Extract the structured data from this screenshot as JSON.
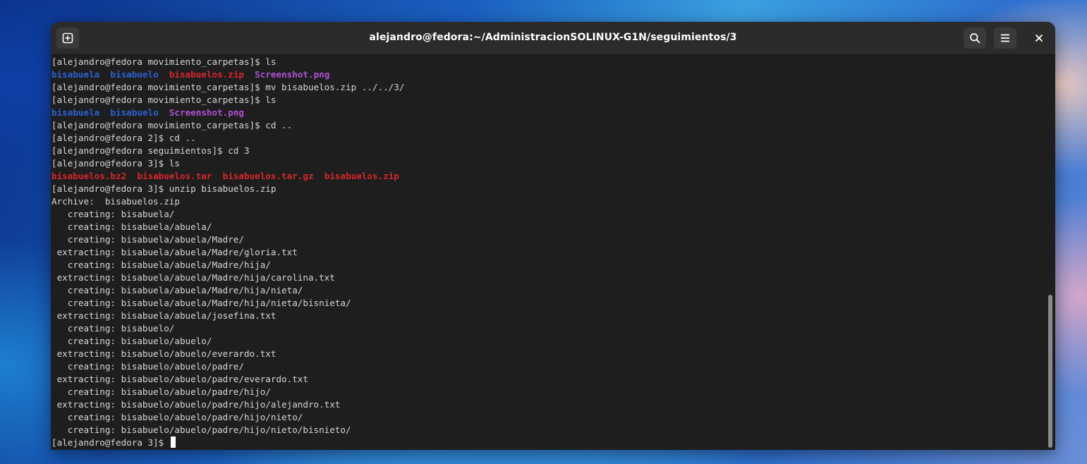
{
  "window": {
    "title": "alejandro@fedora:~/AdministracionSOLINUX-G1N/seguimientos/3"
  },
  "icons": {
    "new_tab": "new-tab-icon",
    "search": "search-icon",
    "menu": "hamburger-menu-icon",
    "close": "close-icon"
  },
  "colors": {
    "directory": "#2a62d6",
    "archive": "#d9262d",
    "image": "#b150d8",
    "text": "#d6d6d6",
    "background": "#1e1e1e"
  },
  "terminal": {
    "lines": [
      [
        {
          "t": "[alejandro@fedora movimiento_carpetas]$ ls",
          "k": ""
        }
      ],
      [
        {
          "t": "bisabuela",
          "k": "dir"
        },
        {
          "t": "  ",
          "k": ""
        },
        {
          "t": "bisabuelo",
          "k": "dir"
        },
        {
          "t": "  ",
          "k": ""
        },
        {
          "t": "bisabuelos.zip",
          "k": "arc"
        },
        {
          "t": "  ",
          "k": ""
        },
        {
          "t": "Screenshot.png",
          "k": "img"
        }
      ],
      [
        {
          "t": "[alejandro@fedora movimiento_carpetas]$ mv bisabuelos.zip ../../3/",
          "k": ""
        }
      ],
      [
        {
          "t": "[alejandro@fedora movimiento_carpetas]$ ls",
          "k": ""
        }
      ],
      [
        {
          "t": "bisabuela",
          "k": "dir"
        },
        {
          "t": "  ",
          "k": ""
        },
        {
          "t": "bisabuelo",
          "k": "dir"
        },
        {
          "t": "  ",
          "k": ""
        },
        {
          "t": "Screenshot.png",
          "k": "img"
        }
      ],
      [
        {
          "t": "[alejandro@fedora movimiento_carpetas]$ cd ..",
          "k": ""
        }
      ],
      [
        {
          "t": "[alejandro@fedora 2]$ cd ..",
          "k": ""
        }
      ],
      [
        {
          "t": "[alejandro@fedora seguimientos]$ cd 3",
          "k": ""
        }
      ],
      [
        {
          "t": "[alejandro@fedora 3]$ ls",
          "k": ""
        }
      ],
      [
        {
          "t": "bisabuelos.bz2",
          "k": "arc"
        },
        {
          "t": "  ",
          "k": ""
        },
        {
          "t": "bisabuelos.tar",
          "k": "arc"
        },
        {
          "t": "  ",
          "k": ""
        },
        {
          "t": "bisabuelos.tar.gz",
          "k": "arc"
        },
        {
          "t": "  ",
          "k": ""
        },
        {
          "t": "bisabuelos.zip",
          "k": "arc"
        }
      ],
      [
        {
          "t": "[alejandro@fedora 3]$ unzip bisabuelos.zip",
          "k": ""
        }
      ],
      [
        {
          "t": "Archive:  bisabuelos.zip",
          "k": ""
        }
      ],
      [
        {
          "t": "   creating: bisabuela/",
          "k": ""
        }
      ],
      [
        {
          "t": "   creating: bisabuela/abuela/",
          "k": ""
        }
      ],
      [
        {
          "t": "   creating: bisabuela/abuela/Madre/",
          "k": ""
        }
      ],
      [
        {
          "t": " extracting: bisabuela/abuela/Madre/gloria.txt",
          "k": ""
        }
      ],
      [
        {
          "t": "   creating: bisabuela/abuela/Madre/hija/",
          "k": ""
        }
      ],
      [
        {
          "t": " extracting: bisabuela/abuela/Madre/hija/carolina.txt",
          "k": ""
        }
      ],
      [
        {
          "t": "   creating: bisabuela/abuela/Madre/hija/nieta/",
          "k": ""
        }
      ],
      [
        {
          "t": "   creating: bisabuela/abuela/Madre/hija/nieta/bisnieta/",
          "k": ""
        }
      ],
      [
        {
          "t": " extracting: bisabuela/abuela/josefina.txt",
          "k": ""
        }
      ],
      [
        {
          "t": "   creating: bisabuelo/",
          "k": ""
        }
      ],
      [
        {
          "t": "   creating: bisabuelo/abuelo/",
          "k": ""
        }
      ],
      [
        {
          "t": " extracting: bisabuelo/abuelo/everardo.txt",
          "k": ""
        }
      ],
      [
        {
          "t": "   creating: bisabuelo/abuelo/padre/",
          "k": ""
        }
      ],
      [
        {
          "t": " extracting: bisabuelo/abuelo/padre/everardo.txt",
          "k": ""
        }
      ],
      [
        {
          "t": "   creating: bisabuelo/abuelo/padre/hijo/",
          "k": ""
        }
      ],
      [
        {
          "t": " extracting: bisabuelo/abuelo/padre/hijo/alejandro.txt",
          "k": ""
        }
      ],
      [
        {
          "t": "   creating: bisabuelo/abuelo/padre/hijo/nieto/",
          "k": ""
        }
      ],
      [
        {
          "t": "   creating: bisabuelo/abuelo/padre/hijo/nieto/bisnieto/",
          "k": ""
        }
      ]
    ],
    "prompt": "[alejandro@fedora 3]$ "
  }
}
